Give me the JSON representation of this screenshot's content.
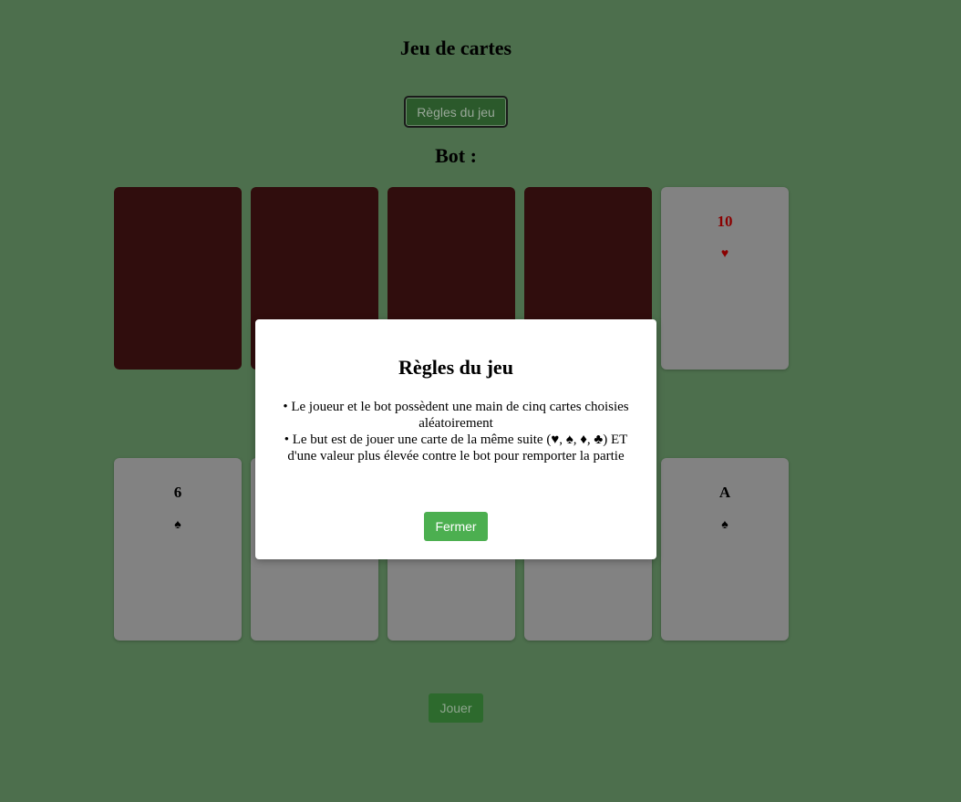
{
  "page": {
    "title": "Jeu de cartes",
    "rules_button": "Règles du jeu",
    "bot_label": "Bot :",
    "play_button": "Jouer"
  },
  "bot_cards": [
    {
      "hidden": true
    },
    {
      "hidden": true
    },
    {
      "hidden": true
    },
    {
      "hidden": true
    },
    {
      "hidden": false,
      "value": "10",
      "suit": "♥",
      "color": "#8a0000"
    }
  ],
  "player_cards": [
    {
      "value": "6",
      "suit": "♠",
      "color": "#000000"
    },
    {
      "value": "",
      "suit": "",
      "color": "#000000"
    },
    {
      "value": "",
      "suit": "",
      "color": "#000000"
    },
    {
      "value": "",
      "suit": "",
      "color": "#000000"
    },
    {
      "value": "A",
      "suit": "♠",
      "color": "#000000"
    }
  ],
  "modal": {
    "title": "Règles du jeu",
    "rule_1": "• Le joueur et le bot possèdent une main de cinq cartes choisies aléatoirement",
    "rule_2": "• Le but est de jouer une carte de la même suite (♥, ♠, ♦, ♣) ET d'une valeur plus élevée contre le bot pour remporter la partie",
    "close_button": "Fermer"
  },
  "colors": {
    "background": "#4d6f4d",
    "card_back": "#300d0d",
    "card_face": "#828282",
    "close_button": "#4caf50"
  }
}
